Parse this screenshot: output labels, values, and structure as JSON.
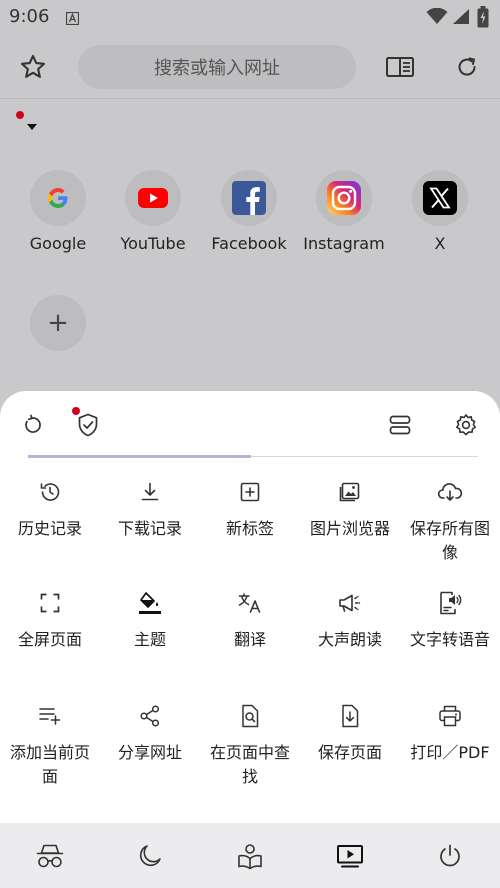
{
  "status_bar": {
    "time": "9:06",
    "app_icon": "A",
    "icons": [
      "wifi-icon",
      "signal-icon",
      "battery-charging-icon"
    ]
  },
  "toolbar": {
    "search_placeholder": "搜索或输入网址",
    "icons": [
      "star-icon",
      "reader-mode-icon",
      "refresh-icon"
    ]
  },
  "shortcuts": [
    {
      "label": "Google",
      "icon": "google-logo"
    },
    {
      "label": "YouTube",
      "icon": "youtube-logo"
    },
    {
      "label": "Facebook",
      "icon": "facebook-logo"
    },
    {
      "label": "Instagram",
      "icon": "instagram-logo"
    },
    {
      "label": "X",
      "icon": "x-logo"
    }
  ],
  "add_shortcut_symbol": "+",
  "sheet": {
    "top_icons": [
      "restore-icon",
      "shield-check-icon",
      "layout-toggle-icon",
      "settings-gear-icon"
    ],
    "page_indicator": {
      "pages": 2,
      "current": 1
    },
    "menu": [
      {
        "label": "历史记录",
        "icon": "history-icon"
      },
      {
        "label": "下载记录",
        "icon": "download-icon"
      },
      {
        "label": "新标签",
        "icon": "new-tab-icon"
      },
      {
        "label": "图片浏览器",
        "icon": "image-viewer-icon"
      },
      {
        "label": "保存所有图像",
        "icon": "cloud-download-icon"
      },
      {
        "label": "全屏页面",
        "icon": "fullscreen-icon"
      },
      {
        "label": "主题",
        "icon": "paint-bucket-icon"
      },
      {
        "label": "翻译",
        "icon": "translate-icon"
      },
      {
        "label": "大声朗读",
        "icon": "megaphone-icon"
      },
      {
        "label": "文字转语音",
        "icon": "text-to-speech-icon"
      },
      {
        "label": "添加当前页面",
        "icon": "add-to-list-icon"
      },
      {
        "label": "分享网址",
        "icon": "share-icon"
      },
      {
        "label": "在页面中查找",
        "icon": "find-in-page-icon"
      },
      {
        "label": "保存页面",
        "icon": "save-page-icon"
      },
      {
        "label": "打印／PDF",
        "icon": "print-icon"
      }
    ]
  },
  "bottom_bar": {
    "icons": [
      "incognito-icon",
      "night-mode-icon",
      "reading-icon",
      "video-player-icon",
      "power-icon"
    ]
  },
  "colors": {
    "accent_red": "#d0021b",
    "youtube_red": "#ff0000",
    "facebook_blue": "#1877f2",
    "progress": "#b3b6d6"
  }
}
